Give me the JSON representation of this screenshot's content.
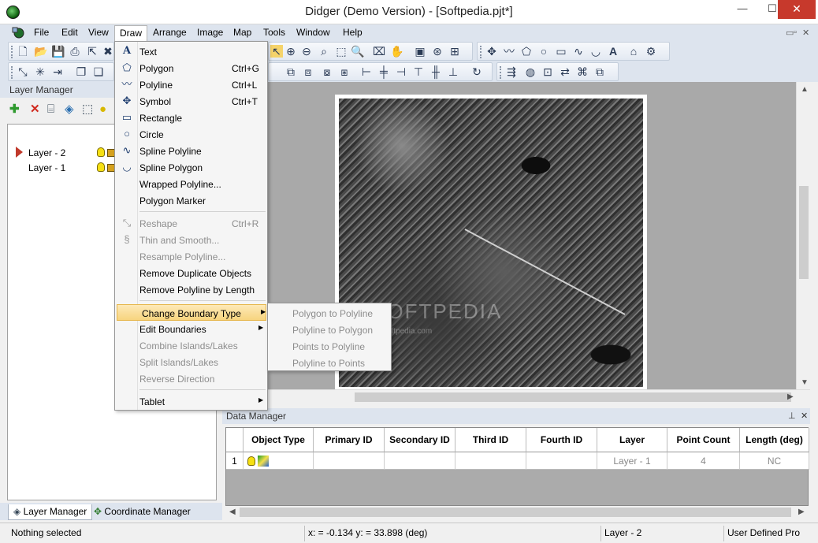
{
  "window": {
    "title": "Didger (Demo Version) - [Softpedia.pjt*]",
    "minimize": "—",
    "maximize": "☐",
    "close": "✕"
  },
  "menubar": {
    "items": [
      "File",
      "Edit",
      "View",
      "Draw",
      "Arrange",
      "Image",
      "Map",
      "Tools",
      "Window",
      "Help"
    ],
    "active": "Draw",
    "mdi_controls": [
      "▭",
      "▫",
      "✕"
    ]
  },
  "layer_manager": {
    "title": "Layer Manager",
    "layers": [
      {
        "name": "Layer - 2",
        "active": true
      },
      {
        "name": "Layer - 1",
        "active": false
      }
    ],
    "tabs": [
      "Layer Manager",
      "Coordinate Manager"
    ]
  },
  "draw_menu": {
    "items": [
      {
        "label": "Text",
        "shortcut": "",
        "icon": "text-icon",
        "glyph": "A",
        "disabled": false,
        "submenu": false
      },
      {
        "label": "Polygon",
        "shortcut": "Ctrl+G",
        "icon": "polygon-icon",
        "glyph": "⬠",
        "disabled": false,
        "submenu": false
      },
      {
        "label": "Polyline",
        "shortcut": "Ctrl+L",
        "icon": "polyline-icon",
        "glyph": "〰",
        "disabled": false,
        "submenu": false
      },
      {
        "label": "Symbol",
        "shortcut": "Ctrl+T",
        "icon": "symbol-icon",
        "glyph": "✥",
        "disabled": false,
        "submenu": false
      },
      {
        "label": "Rectangle",
        "shortcut": "",
        "icon": "rectangle-icon",
        "glyph": "▭",
        "disabled": false,
        "submenu": false
      },
      {
        "label": "Circle",
        "shortcut": "",
        "icon": "circle-icon",
        "glyph": "○",
        "disabled": false,
        "submenu": false
      },
      {
        "label": "Spline Polyline",
        "shortcut": "",
        "icon": "spline-polyline-icon",
        "glyph": "∿",
        "disabled": false,
        "submenu": false
      },
      {
        "label": "Spline Polygon",
        "shortcut": "",
        "icon": "spline-polygon-icon",
        "glyph": "◡",
        "disabled": false,
        "submenu": false
      },
      {
        "label": "Wrapped Polyline...",
        "shortcut": "",
        "icon": "",
        "glyph": "",
        "disabled": false,
        "submenu": false
      },
      {
        "label": "Polygon Marker",
        "shortcut": "",
        "icon": "",
        "glyph": "",
        "disabled": false,
        "submenu": false
      },
      {
        "label": "Reshape",
        "shortcut": "Ctrl+R",
        "icon": "reshape-icon",
        "glyph": "⤡",
        "disabled": true,
        "submenu": false,
        "sep_before": true
      },
      {
        "label": "Thin and Smooth...",
        "shortcut": "",
        "icon": "thin-smooth-icon",
        "glyph": "§",
        "disabled": true,
        "submenu": false
      },
      {
        "label": "Resample Polyline...",
        "shortcut": "",
        "icon": "",
        "glyph": "",
        "disabled": true,
        "submenu": false
      },
      {
        "label": "Remove Duplicate Objects",
        "shortcut": "",
        "icon": "",
        "glyph": "",
        "disabled": false,
        "submenu": false
      },
      {
        "label": "Remove Polyline by Length",
        "shortcut": "",
        "icon": "",
        "glyph": "",
        "disabled": false,
        "submenu": false
      },
      {
        "label": "Change Boundary Type",
        "shortcut": "",
        "icon": "",
        "glyph": "",
        "disabled": false,
        "submenu": true,
        "highlighted": true,
        "sep_before": true
      },
      {
        "label": "Edit Boundaries",
        "shortcut": "",
        "icon": "",
        "glyph": "",
        "disabled": false,
        "submenu": true
      },
      {
        "label": "Combine Islands/Lakes",
        "shortcut": "",
        "icon": "",
        "glyph": "",
        "disabled": true,
        "submenu": false
      },
      {
        "label": "Split Islands/Lakes",
        "shortcut": "",
        "icon": "",
        "glyph": "",
        "disabled": true,
        "submenu": false
      },
      {
        "label": "Reverse Direction",
        "shortcut": "",
        "icon": "",
        "glyph": "",
        "disabled": true,
        "submenu": false
      },
      {
        "label": "Tablet",
        "shortcut": "",
        "icon": "",
        "glyph": "",
        "disabled": false,
        "submenu": true,
        "sep_before": true
      }
    ]
  },
  "boundary_submenu": {
    "items": [
      "Polygon to Polyline",
      "Polyline to Polygon",
      "Points to Polyline",
      "Polyline to Points"
    ]
  },
  "map": {
    "watermark": "SOFTPEDIA",
    "watermark_sub": "www.softpedia.com"
  },
  "data_manager": {
    "title": "Data Manager",
    "columns": [
      "Object Type",
      "Primary ID",
      "Secondary ID",
      "Third ID",
      "Fourth ID",
      "Layer",
      "Point Count",
      "Length (deg)"
    ],
    "rows": [
      {
        "index": "1",
        "object_type": "",
        "primary_id": "",
        "secondary_id": "",
        "third_id": "",
        "fourth_id": "",
        "layer": "Layer - 1",
        "point_count": "4",
        "length": "NC"
      }
    ]
  },
  "status_bar": {
    "selection": "Nothing selected",
    "coords": "x: = -0.134 y: = 33.898 (deg)",
    "layer": "Layer - 2",
    "projection": "User Defined Pro"
  }
}
